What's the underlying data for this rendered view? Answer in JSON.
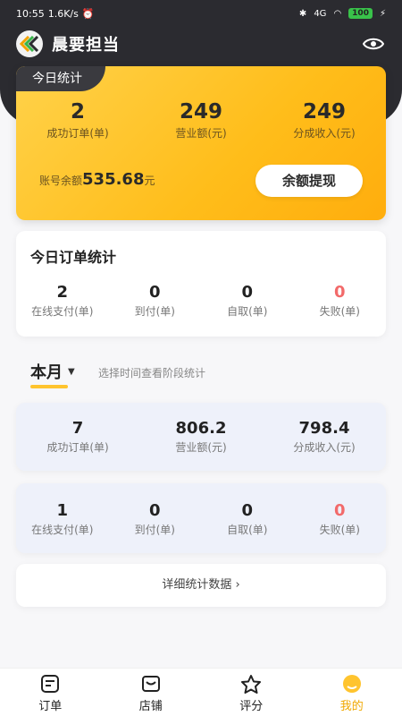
{
  "status_bar": {
    "time": "10:55",
    "speed": "1.6K/s",
    "network": "4G",
    "battery": "100"
  },
  "header": {
    "title": "晨要担当"
  },
  "today": {
    "tag": "今日统计",
    "stats": [
      {
        "value": "2",
        "label": "成功订单(单)"
      },
      {
        "value": "249",
        "label": "营业额(元)"
      },
      {
        "value": "249",
        "label": "分成收入(元)"
      }
    ],
    "balance_label": "账号余额",
    "balance_value": "535.68",
    "balance_unit": "元",
    "withdraw_label": "余额提现"
  },
  "today_orders": {
    "title": "今日订单统计",
    "stats": [
      {
        "value": "2",
        "label": "在线支付(单)"
      },
      {
        "value": "0",
        "label": "到付(单)"
      },
      {
        "value": "0",
        "label": "自取(单)"
      },
      {
        "value": "0",
        "label": "失败(单)"
      }
    ]
  },
  "period": {
    "selected": "本月",
    "hint": "选择时间查看阶段统计"
  },
  "month_stats": [
    {
      "value": "7",
      "label": "成功订单(单)"
    },
    {
      "value": "806.2",
      "label": "营业额(元)"
    },
    {
      "value": "798.4",
      "label": "分成收入(元)"
    }
  ],
  "month_orders": [
    {
      "value": "1",
      "label": "在线支付(单)"
    },
    {
      "value": "0",
      "label": "到付(单)"
    },
    {
      "value": "0",
      "label": "自取(单)"
    },
    {
      "value": "0",
      "label": "失败(单)"
    }
  ],
  "detail_button": {
    "label": "详细统计数据",
    "icon": "chevron-right-icon"
  },
  "tabbar": [
    {
      "label": "订单",
      "icon": "order-icon"
    },
    {
      "label": "店铺",
      "icon": "shop-icon"
    },
    {
      "label": "评分",
      "icon": "star-icon"
    },
    {
      "label": "我的",
      "icon": "profile-icon",
      "active": true
    }
  ],
  "colors": {
    "accent": "#ffbd1a",
    "dark": "#2b2b30",
    "fail": "#f26a6a",
    "active_tab": "#f0a800"
  }
}
